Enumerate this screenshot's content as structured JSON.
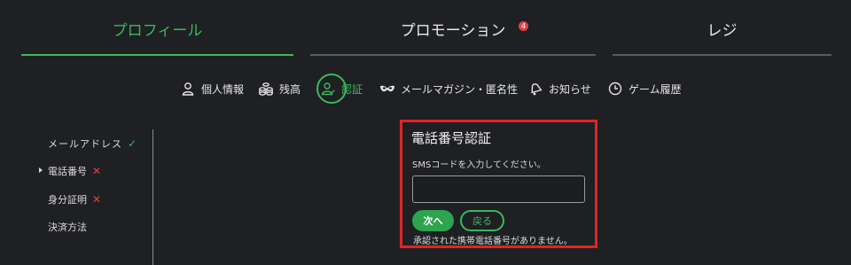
{
  "tabs": [
    {
      "label": "プロフィール",
      "active": true
    },
    {
      "label": "プロモーション",
      "badge": "4",
      "active": false
    },
    {
      "label": "レジ",
      "active": false
    }
  ],
  "subnav": [
    {
      "label": "個人情報",
      "icon": "person-icon"
    },
    {
      "label": "残高",
      "icon": "coins-icon"
    },
    {
      "label": "認証",
      "icon": "verification-icon",
      "active": true
    },
    {
      "label": "メールマガジン・匿名性",
      "icon": "mask-icon"
    },
    {
      "label": "お知らせ",
      "icon": "bell-icon"
    },
    {
      "label": "ゲーム履歴",
      "icon": "clock-icon"
    }
  ],
  "sidebar": {
    "items": [
      {
        "label": "メールアドレス",
        "status": "ok",
        "status_mark": "✓"
      },
      {
        "label": "電話番号",
        "status": "missing",
        "status_mark": "✕",
        "selected": true
      },
      {
        "label": "身分証明",
        "status": "missing",
        "status_mark": "✕"
      },
      {
        "label": "決済方法"
      }
    ]
  },
  "panel": {
    "title": "電話番号認証",
    "description": "SMSコードを入力してください。",
    "input_value": "",
    "next_label": "次へ",
    "back_label": "戻る",
    "note": "承認された携帯電話番号がありません。"
  },
  "colors": {
    "accent": "#3bb85a",
    "highlight_border": "#e22424",
    "error": "#e34141",
    "background": "#1f2024"
  }
}
